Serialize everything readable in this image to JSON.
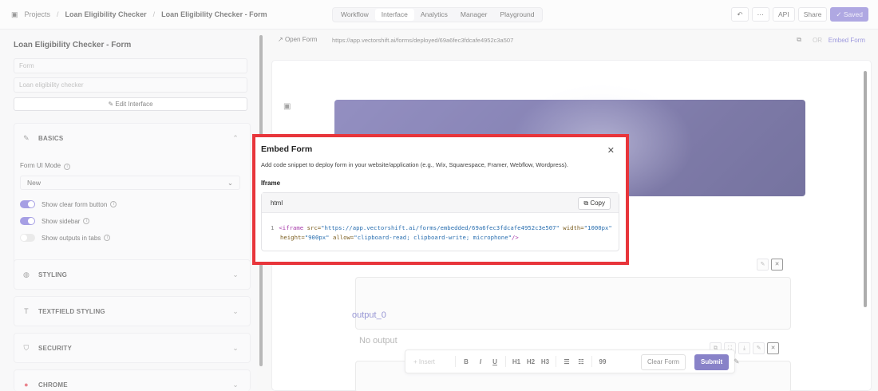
{
  "breadcrumb": {
    "projects": "Projects",
    "project": "Loan Eligibility Checker",
    "page": "Loan Eligibility Checker - Form"
  },
  "nav_tabs": [
    "Workflow",
    "Interface",
    "Analytics",
    "Manager",
    "Playground"
  ],
  "top_actions": {
    "api": "API",
    "share": "Share",
    "saved": "Saved"
  },
  "left_panel": {
    "title": "Loan Eligibility Checker - Form",
    "field1_placeholder": "Form",
    "field2_placeholder": "Loan eligibility checker",
    "edit_button": "Edit Interface",
    "sections": {
      "basics": "BASICS",
      "styling": "STYLING",
      "textfield_styling": "TEXTFIELD STYLING",
      "security": "SECURITY",
      "chrome": "CHROME"
    },
    "form_ui_mode_label": "Form UI Mode",
    "form_ui_mode_value": "New",
    "toggles": {
      "clear_button": "Show clear form button",
      "sidebar": "Show sidebar",
      "outputs_tabs": "Show outputs in tabs"
    }
  },
  "url_bar": {
    "open_form": "Open Form",
    "url": "https://app.vectorshift.ai/forms/deployed/69a6fec3fdcafe4952c3a507",
    "or": "OR",
    "embed_form": "Embed Form"
  },
  "canvas": {
    "output_label": "output_0",
    "output_placeholder": "No output"
  },
  "toolbar": {
    "insert": "+ Insert",
    "bold": "B",
    "italic": "I",
    "underline": "U",
    "h1": "H1",
    "h2": "H2",
    "h3": "H3",
    "quote": "99",
    "clear_form": "Clear Form",
    "submit": "Submit"
  },
  "modal": {
    "title": "Embed Form",
    "description": "Add code snippet to deploy form in your website/application (e.g., Wix, Squarespace, Framer, Webflow, Wordpress).",
    "iframe_label": "Iframe",
    "code_lang": "html",
    "copy_label": "Copy",
    "line_number": "1",
    "code": {
      "tag_open": "<iframe",
      "src_attr": "src=",
      "src_value": "\"https://app.vectorshift.ai/forms/embedded/69a6fec3fdcafe4952c3e507\"",
      "width_attr": "width=",
      "width_value": "\"1000px\"",
      "height_attr": "height=",
      "height_value": "\"900px\"",
      "allow_attr": "allow=",
      "allow_value": "\"clipboard-read; clipboard-write; microphone\"",
      "tag_close": "/>"
    }
  },
  "colors": {
    "accent": "#6b5fd3",
    "highlight_border": "#e8353b",
    "submit": "#3a2fa3"
  }
}
